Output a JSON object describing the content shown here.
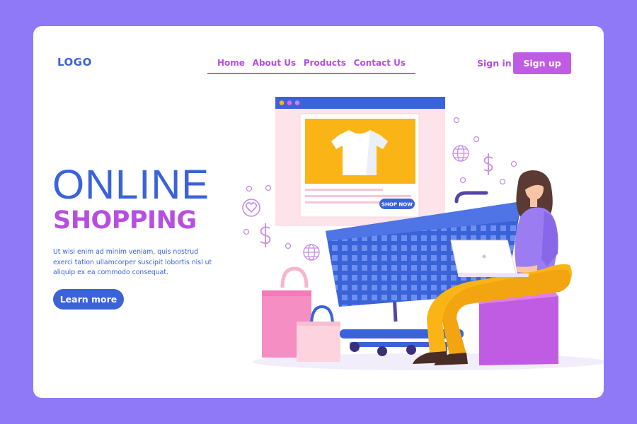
{
  "header": {
    "logo": "LOGO",
    "nav": [
      "Home",
      "About Us",
      "Products",
      "Contact Us"
    ],
    "sign_in": "Sign in",
    "sign_up": "Sign up"
  },
  "hero": {
    "title_line1": "ONLINE",
    "title_line2": "SHOPPING",
    "description": "Ut wisi enim ad minim veniam, quis nostrud exerci tation ullamcorper suscipit lobortis nisl ut aliquip ex ea commodo consequat.",
    "cta": "Learn more"
  },
  "product_card": {
    "button": "SHOP NOW"
  },
  "colors": {
    "background": "#8f79f7",
    "primary_blue": "#3b63d8",
    "accent_purple": "#c05be4",
    "product_yellow": "#fbb416",
    "card_pink": "#fde3ea"
  }
}
